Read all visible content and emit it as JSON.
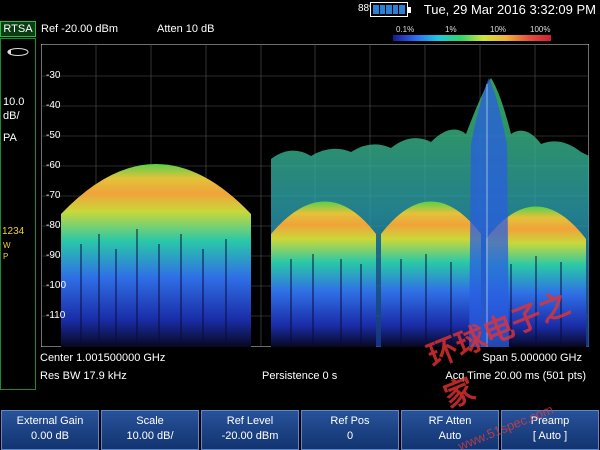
{
  "status_bar": {
    "battery_percent": "88%",
    "datetime": "Tue, 29 Mar 2016 3:32:09 PM"
  },
  "mode": "RTSA",
  "header": {
    "ref_level": "Ref -20.00 dBm",
    "atten": "Atten 10 dB"
  },
  "persistence_legend": {
    "labels": [
      "0.1%",
      "1%",
      "10%",
      "100%"
    ]
  },
  "left_panel": {
    "scale_value": "10.0",
    "scale_unit": "dB/",
    "detector": "PA",
    "traces": "1234",
    "trace_mode_line1": "W",
    "trace_mode_line2": "P"
  },
  "y_axis": {
    "ticks": [
      "-30",
      "-40",
      "-50",
      "-60",
      "-70",
      "-80",
      "-90",
      "-100",
      "-110"
    ]
  },
  "spectrum_readout": {
    "center": "Center 1.001500000 GHz",
    "span": "Span 5.000000 GHz",
    "res_bw": "Res BW 17.9 kHz",
    "persistence": "Persistence 0  s",
    "acq_time": "Acq Time 20.00 ms (501 pts)"
  },
  "softkeys": [
    {
      "title": "External Gain",
      "value": "0.00 dB"
    },
    {
      "title": "Scale",
      "value": "10.00 dB/"
    },
    {
      "title": "Ref Level",
      "value": "-20.00 dBm"
    },
    {
      "title": "Ref Pos",
      "value": "0"
    },
    {
      "title": "RF Atten",
      "value": "Auto"
    },
    {
      "title": "Preamp",
      "value": "[ Auto ]"
    }
  ],
  "watermark": {
    "text": "环球电子之家",
    "url": "www.51spec.com"
  },
  "colors": {
    "accent_green": "#24c03b",
    "softkey_blue": "#1e4488",
    "trace_yellow": "#f2d21e"
  }
}
